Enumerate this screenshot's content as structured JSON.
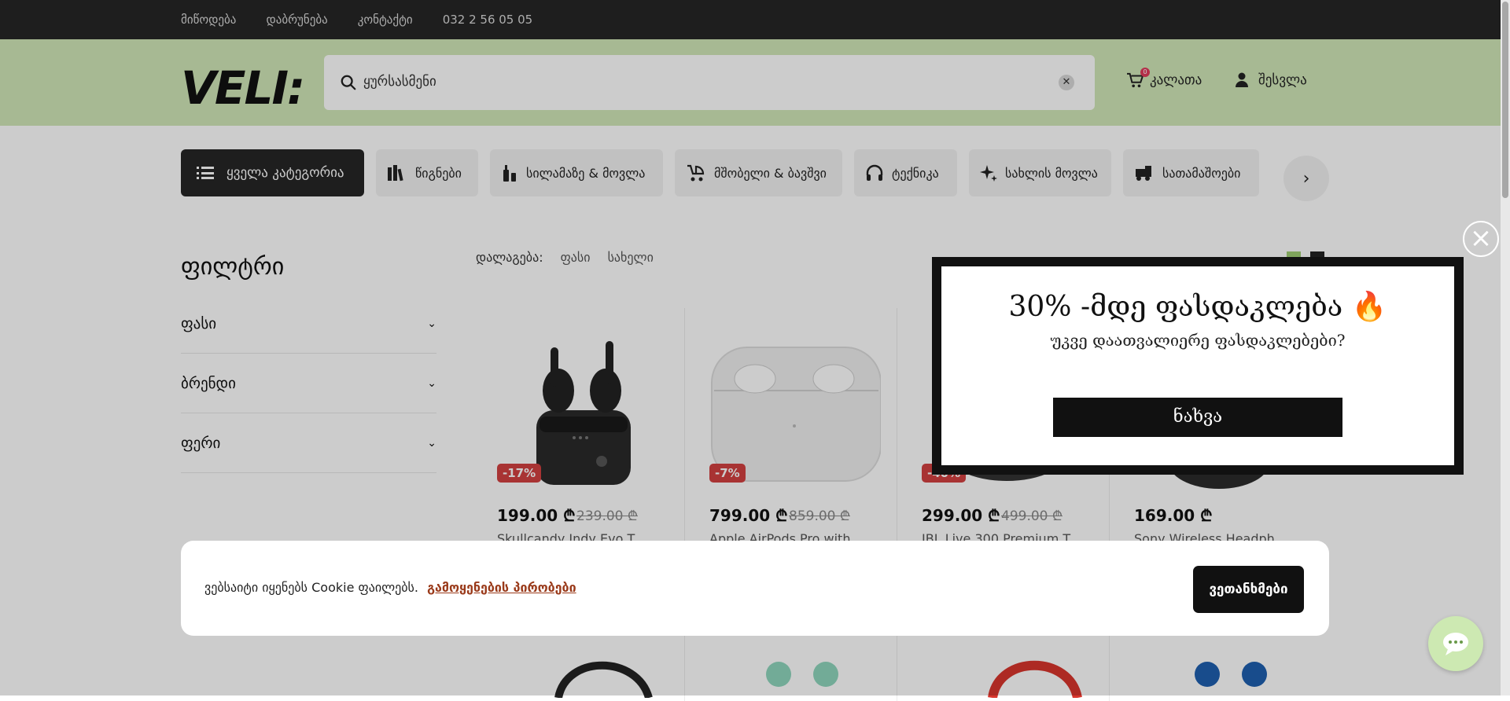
{
  "topbar": {
    "links": [
      "მიწოდება",
      "დაბრუნება",
      "კონტაქტი",
      "032 2 56 05 05"
    ]
  },
  "header": {
    "logo": "VELI:",
    "search_value": "ყურსასმენი",
    "cart_label": "კალათა",
    "cart_count": "0",
    "login_label": "შესვლა"
  },
  "categories": {
    "all_label": "ყველა კატეგორია",
    "items": [
      "წიგნები",
      "სილამაზე & მოვლა",
      "მშობელი & ბავშვი",
      "ტექნიკა",
      "სახლის მოვლა",
      "სათამაშოები"
    ]
  },
  "filters": {
    "title": "ფილტრი",
    "items": [
      "ფასი",
      "ბრენდი",
      "ფერი"
    ]
  },
  "sort": {
    "label": "დალაგება:",
    "options": [
      "ფასი",
      "სახელი"
    ]
  },
  "products": [
    {
      "discount": "-17%",
      "price": "199.00 ₾",
      "old_price": "239.00 ₾",
      "name": "Skullcandy Indy Evo T"
    },
    {
      "discount": "-7%",
      "price": "799.00 ₾",
      "old_price": "859.00 ₾",
      "name": "Apple AirPods Pro with"
    },
    {
      "discount": "-40%",
      "price": "299.00 ₾",
      "old_price": "499.00 ₾",
      "name": "JBL Live 300 Premium T"
    },
    {
      "discount": "",
      "price": "169.00 ₾",
      "old_price": "",
      "name": "Sony Wireless Headph"
    }
  ],
  "popup": {
    "headline": "30% -მდე ფასდაკლება 🔥",
    "subline": "უკვე დაათვალიერე ფასდაკლებები?",
    "button": "ნახვა"
  },
  "cookie": {
    "text": "ვებსაიტი იყენებს Cookie ფაილებს.",
    "link": "გამოყენების პირობები",
    "accept": "ვეთანხმები"
  },
  "colors": {
    "header_bg": "#d1e8b8",
    "topbar_bg": "#262626",
    "discount": "#d34040",
    "accent": "#cde9b2"
  }
}
